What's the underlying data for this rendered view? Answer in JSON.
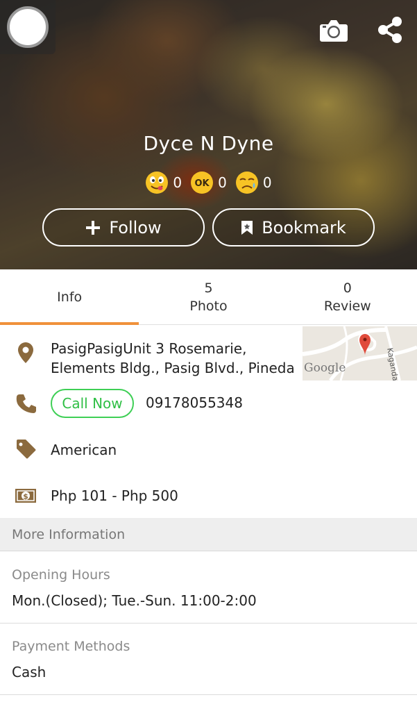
{
  "header": {
    "restaurant_name": "Dyce N Dyne",
    "reactions": [
      {
        "icon": "yummy-face-icon",
        "count": "0"
      },
      {
        "icon": "ok-badge-icon",
        "label": "OK",
        "count": "0"
      },
      {
        "icon": "sad-face-icon",
        "count": "0"
      }
    ],
    "follow_label": "Follow",
    "bookmark_label": "Bookmark"
  },
  "tabs": [
    {
      "label": "Info",
      "count": ""
    },
    {
      "label": "Photo",
      "count": "5"
    },
    {
      "label": "Review",
      "count": "0"
    }
  ],
  "info": {
    "address_line1": "PasigPasigUnit 3 Rosemarie,",
    "address_line2": "Elements Bldg., Pasig Blvd., Pineda",
    "map_label": "Google",
    "map_street_label": "Kagandal",
    "call_label": "Call Now",
    "phone": "09178055348",
    "cuisine": "American",
    "price_range": "Php 101 - Php 500"
  },
  "more_info": {
    "section_title": "More Information",
    "opening_hours_label": "Opening Hours",
    "opening_hours_value": "Mon.(Closed); Tue.-Sun. 11:00-2:00",
    "payment_label": "Payment Methods",
    "payment_value": "Cash"
  },
  "colors": {
    "accent_orange": "#f0913a",
    "icon_brown": "#8b6a3e",
    "call_green": "#3ecf55"
  }
}
